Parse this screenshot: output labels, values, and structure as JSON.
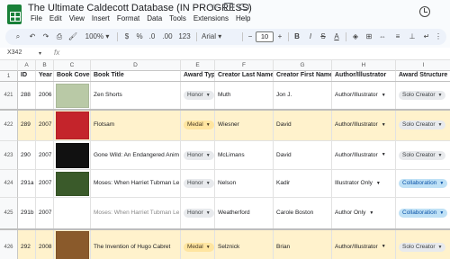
{
  "title": "The Ultimate Caldecott Database (IN PROGRESS)",
  "menu": [
    "File",
    "Edit",
    "View",
    "Insert",
    "Format",
    "Data",
    "Tools",
    "Extensions",
    "Help"
  ],
  "toolbar": {
    "zoom": "100%",
    "currency": "$",
    "percent": "%",
    "decrease_decimal": ".0",
    "increase_decimal": ".00",
    "more_formats": "123",
    "font": "Arial",
    "font_size": "10"
  },
  "name_box": "X342",
  "fx_label": "fx",
  "columns": [
    "A",
    "B",
    "C",
    "D",
    "E",
    "F",
    "G",
    "H",
    "I"
  ],
  "header_row": {
    "row_num": "1",
    "cells": [
      "ID",
      "Year",
      "Book Cover",
      "Book Title",
      "Award Type",
      "Creator Last Name",
      "Creator First Name",
      "Author/Illustrator",
      "Award Structure"
    ]
  },
  "rows": [
    {
      "row_num": "421",
      "id": "288",
      "year": "2006",
      "title": "Zen Shorts",
      "award": "Honor",
      "last": "Muth",
      "first": "Jon J.",
      "role": "Author/Illustrator",
      "structure": "Solo Creator",
      "cover_color": "#b9c9a6"
    },
    {
      "row_num": "422",
      "id": "289",
      "year": "2007",
      "title": "Flotsam",
      "award": "Medal",
      "last": "Wiesner",
      "first": "David",
      "role": "Author/Illustrator",
      "structure": "Solo Creator",
      "cover_color": "#c4242b"
    },
    {
      "row_num": "423",
      "id": "290",
      "year": "2007",
      "title": "Gone Wild: An Endangered Anim",
      "award": "Honor",
      "last": "McLimans",
      "first": "David",
      "role": "Author/Illustrator",
      "structure": "Solo Creator",
      "cover_color": "#111111"
    },
    {
      "row_num": "424",
      "id": "291a",
      "year": "2007",
      "title": "Moses: When Harriet Tubman Le",
      "award": "Honor",
      "last": "Nelson",
      "first": "Kadir",
      "role": "Illustrator Only",
      "structure": "Collaboration",
      "cover_color": "#3a5a2a"
    },
    {
      "row_num": "425",
      "id": "291b",
      "year": "2007",
      "title": "Moses: When Harriet Tubman Le",
      "award": "Honor",
      "last": "Weatherford",
      "first": "Carole Boston",
      "role": "Author Only",
      "structure": "Collaboration",
      "cover_color": ""
    },
    {
      "row_num": "426",
      "id": "292",
      "year": "2008",
      "title": "The Invention of Hugo Cabret",
      "award": "Medal",
      "last": "Selznick",
      "first": "Brian",
      "role": "Author/Illustrator",
      "structure": "Solo Creator",
      "cover_color": "#8a5a2b"
    }
  ],
  "colors": {
    "medal_row": "#fff2cc",
    "honor_chip": "#e8eaed",
    "medal_chip": "#ffe5a0",
    "collab_chip": "#bfe1f6",
    "sheets_green": "#188038"
  }
}
